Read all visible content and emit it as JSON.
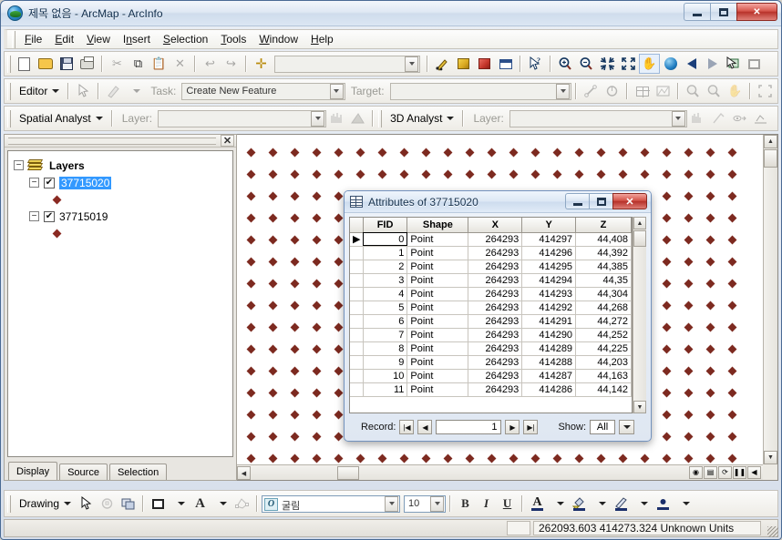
{
  "window": {
    "title": "제목 없음 - ArcMap - ArcInfo",
    "app_icon": "arcmap-globe-icon",
    "minimize_label": "Minimize",
    "maximize_label": "Maximize",
    "close_label": "✕"
  },
  "menubar": {
    "items": [
      {
        "label": "File"
      },
      {
        "label": "Edit"
      },
      {
        "label": "View"
      },
      {
        "label": "Insert"
      },
      {
        "label": "Selection"
      },
      {
        "label": "Tools"
      },
      {
        "label": "Window"
      },
      {
        "label": "Help"
      }
    ]
  },
  "standard_toolbar": {
    "buttons": [
      {
        "name": "new-document-icon"
      },
      {
        "name": "open-document-icon"
      },
      {
        "name": "save-icon"
      },
      {
        "name": "print-icon"
      },
      {
        "name": "cut-icon",
        "glyph": "✂"
      },
      {
        "name": "copy-icon",
        "glyph": "⧉"
      },
      {
        "name": "paste-icon",
        "glyph": "📋"
      },
      {
        "name": "delete-icon",
        "glyph": "✕"
      },
      {
        "name": "undo-icon",
        "glyph": "↰"
      },
      {
        "name": "redo-icon",
        "glyph": "↱"
      },
      {
        "name": "add-data-icon",
        "glyph": "✛"
      }
    ],
    "scale_combo": {
      "value": "",
      "placeholder": ""
    },
    "right_buttons": [
      {
        "name": "editor-toolbox-icon"
      },
      {
        "name": "arctoolbox-icon"
      },
      {
        "name": "model-builder-icon"
      },
      {
        "name": "command-line-icon"
      },
      {
        "name": "whats-this-icon",
        "glyph": "↖?"
      },
      {
        "name": "zoom-in-icon"
      },
      {
        "name": "zoom-out-icon"
      },
      {
        "name": "fixed-zoom-in-icon",
        "glyph": "⤡"
      },
      {
        "name": "fixed-zoom-out-icon",
        "glyph": "⤢"
      },
      {
        "name": "pan-icon",
        "glyph": "✋"
      },
      {
        "name": "full-extent-icon"
      },
      {
        "name": "go-back-extent-icon"
      },
      {
        "name": "go-forward-extent-icon"
      },
      {
        "name": "select-features-icon"
      },
      {
        "name": "clear-selection-icon"
      }
    ]
  },
  "editor_toolbar": {
    "menu_label": "Editor",
    "edit-tool-icon": "arrow-pointer-icon",
    "sketch-tool-icon": "pencil-icon",
    "task_label": "Task:",
    "task_value": "Create New Feature",
    "target_label": "Target:",
    "target_value": "",
    "right_buttons": [
      {
        "name": "split-tool-icon"
      },
      {
        "name": "rotate-tool-icon"
      },
      {
        "name": "attributes-icon"
      },
      {
        "name": "sketch-properties-icon"
      },
      {
        "name": "zoom-in-edit-icon"
      },
      {
        "name": "zoom-out-edit-icon"
      },
      {
        "name": "pan-edit-icon"
      },
      {
        "name": "full-extent-edit-icon"
      }
    ]
  },
  "spatial_analyst_toolbar": {
    "menu_label": "Spatial Analyst",
    "layer_label": "Layer:",
    "layer_value": "",
    "buttons": [
      {
        "name": "histogram-icon"
      },
      {
        "name": "raster-calculator-icon"
      }
    ]
  },
  "threed_analyst_toolbar": {
    "menu_label": "3D Analyst",
    "layer_label": "Layer:",
    "layer_value": "",
    "buttons": [
      {
        "name": "3d-histogram-icon"
      },
      {
        "name": "interpolate-line-icon"
      },
      {
        "name": "line-of-sight-icon"
      },
      {
        "name": "profile-graph-icon"
      }
    ]
  },
  "toc": {
    "close_label": "✕",
    "root": {
      "label": "Layers",
      "icon": "layers-stack-icon",
      "expander": "−"
    },
    "layers": [
      {
        "label": "37715020",
        "checked": true,
        "selected": true,
        "expander": "−",
        "symbol": "point-diamond-symbol"
      },
      {
        "label": "37715019",
        "checked": true,
        "selected": false,
        "expander": "−",
        "symbol": "point-diamond-symbol"
      }
    ],
    "tabs": [
      {
        "label": "Display",
        "active": true
      },
      {
        "label": "Source",
        "active": false
      },
      {
        "label": "Selection",
        "active": false
      }
    ]
  },
  "map": {
    "point_symbol_color": "#7d2a20",
    "background": "#ffffff",
    "grid_spacing_px": 24,
    "view_buttons": [
      {
        "name": "data-view-button",
        "glyph": "◉"
      },
      {
        "name": "layout-view-button",
        "glyph": "▤"
      },
      {
        "name": "refresh-view-button",
        "glyph": "⟳"
      },
      {
        "name": "pause-drawing-button",
        "glyph": "❚❚"
      },
      {
        "name": "previous-page-button",
        "glyph": "◀"
      }
    ]
  },
  "attributes_dialog": {
    "title": "Attributes of 37715020",
    "icon": "table-grid-icon",
    "minimize_label": "Minimize",
    "maximize_label": "Restore",
    "close_label": "✕",
    "columns": [
      "FID",
      "Shape",
      "X",
      "Y",
      "Z"
    ],
    "rows": [
      {
        "fid": "0",
        "shape": "Point",
        "x": "264293",
        "y": "414297",
        "z": "44,408",
        "current": true
      },
      {
        "fid": "1",
        "shape": "Point",
        "x": "264293",
        "y": "414296",
        "z": "44,392",
        "current": false
      },
      {
        "fid": "2",
        "shape": "Point",
        "x": "264293",
        "y": "414295",
        "z": "44,385",
        "current": false
      },
      {
        "fid": "3",
        "shape": "Point",
        "x": "264293",
        "y": "414294",
        "z": "44,35",
        "current": false
      },
      {
        "fid": "4",
        "shape": "Point",
        "x": "264293",
        "y": "414293",
        "z": "44,304",
        "current": false
      },
      {
        "fid": "5",
        "shape": "Point",
        "x": "264293",
        "y": "414292",
        "z": "44,268",
        "current": false
      },
      {
        "fid": "6",
        "shape": "Point",
        "x": "264293",
        "y": "414291",
        "z": "44,272",
        "current": false
      },
      {
        "fid": "7",
        "shape": "Point",
        "x": "264293",
        "y": "414290",
        "z": "44,252",
        "current": false
      },
      {
        "fid": "8",
        "shape": "Point",
        "x": "264293",
        "y": "414289",
        "z": "44,225",
        "current": false
      },
      {
        "fid": "9",
        "shape": "Point",
        "x": "264293",
        "y": "414288",
        "z": "44,203",
        "current": false
      },
      {
        "fid": "10",
        "shape": "Point",
        "x": "264293",
        "y": "414287",
        "z": "44,163",
        "current": false
      },
      {
        "fid": "11",
        "shape": "Point",
        "x": "264293",
        "y": "414286",
        "z": "44,142",
        "current": false
      }
    ],
    "footer": {
      "record_label": "Record:",
      "first_glyph": "|◀",
      "prev_glyph": "◀",
      "record_value": "1",
      "next_glyph": "▶",
      "last_glyph": "▶|",
      "show_label": "Show:",
      "show_value": "All"
    }
  },
  "drawing_toolbar": {
    "menu_label": "Drawing",
    "select_elements_icon": "arrow-pointer-icon",
    "rotate_icon": "rotate-element-icon",
    "group_icon": "group-elements-icon",
    "fill_color_icon": "fill-color-icon",
    "text_color_icon": "font-color-icon",
    "nudge_icon": "edit-vertices-icon",
    "font_value": "굴림",
    "font_size_value": "10",
    "bold_label": "B",
    "italic_label": "I",
    "underline_label": "U",
    "font_color_label": "A",
    "fill_color_label": "◐",
    "line_color_label": "✎",
    "marker_color_label": "●"
  },
  "statusbar": {
    "coordinates": "262093.603  414273.324 Unknown Units"
  }
}
